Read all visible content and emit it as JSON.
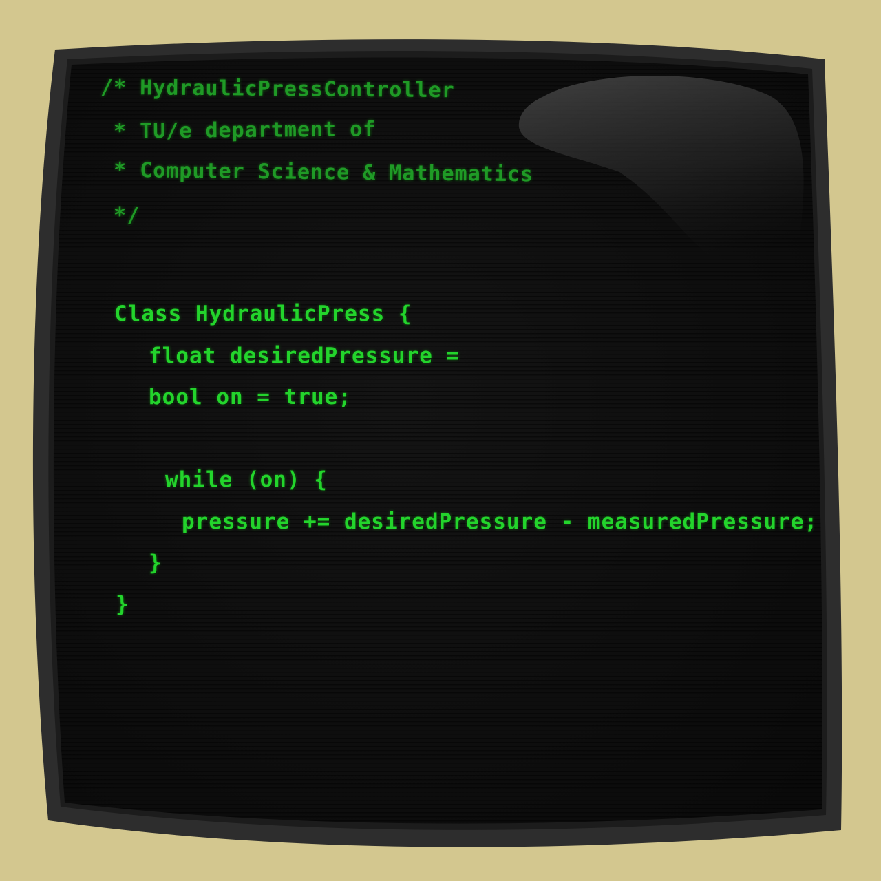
{
  "terminal": {
    "comment_lines": [
      "/* HydraulicPressController",
      " * TU/e department of",
      " * Computer Science & Mathematics",
      " */"
    ],
    "code_lines": [
      "Class HydraulicPress {",
      "float desiredPressure =",
      "bool on = true;",
      "while (on) {",
      "pressure += desiredPressure - measuredPressure;",
      "}",
      "}"
    ]
  },
  "colors": {
    "background": "#d3c78f",
    "bezel": "#2b2b2b",
    "screen": "#0e0e0e",
    "comment_text": "#1f9a26",
    "code_text": "#23d42c"
  }
}
